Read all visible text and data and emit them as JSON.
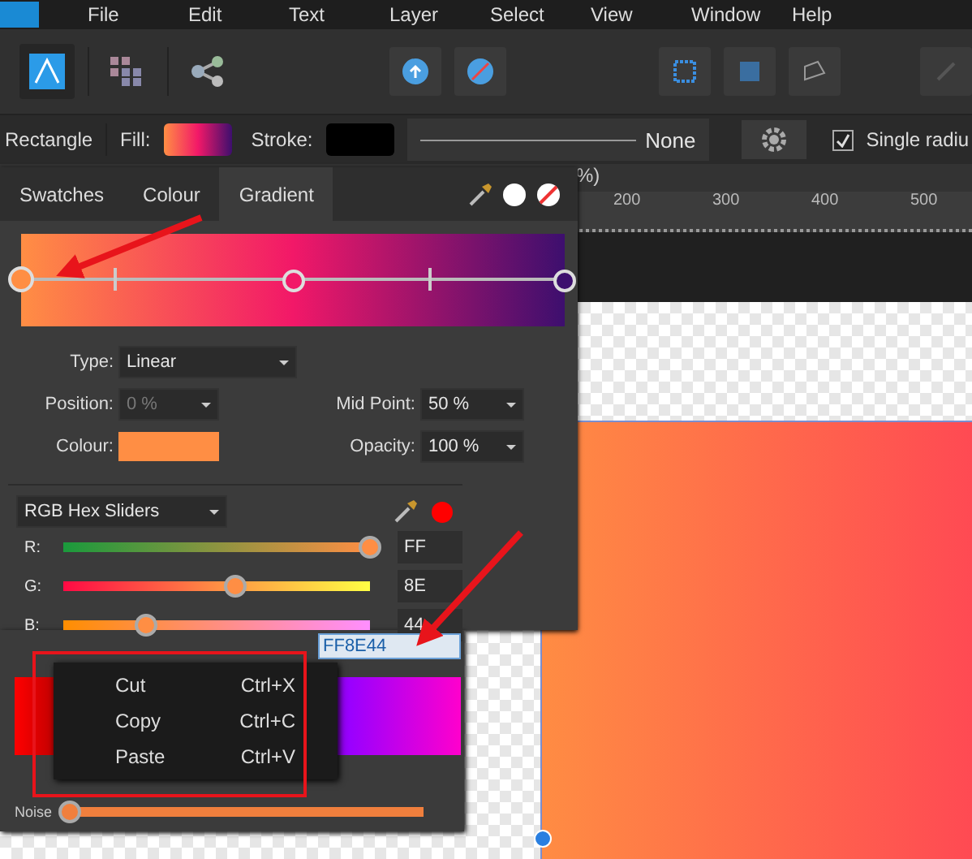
{
  "menu": [
    "File",
    "Edit",
    "Text",
    "Layer",
    "Select",
    "View",
    "Window",
    "Help"
  ],
  "context_bar": {
    "tool": "Rectangle",
    "fill_label": "Fill:",
    "stroke_label": "Stroke:",
    "stroke_style": "None",
    "single_radius": {
      "label": "Single radiu",
      "checked": true
    }
  },
  "document_tab": "%)",
  "ruler": [
    "200",
    "300",
    "400",
    "500"
  ],
  "panel": {
    "tabs": [
      {
        "label": "Swatches",
        "selected": false
      },
      {
        "label": "Colour",
        "selected": false
      },
      {
        "label": "Gradient",
        "selected": true
      }
    ],
    "stops": [
      {
        "color": "#ff8e44",
        "selected": true
      },
      {
        "color": "#f21868",
        "selected": false
      },
      {
        "color": "#3d0f6e",
        "selected": false
      }
    ],
    "type": {
      "label": "Type:",
      "value": "Linear"
    },
    "position": {
      "label": "Position:",
      "value": "0 %",
      "disabled": true
    },
    "mid_point": {
      "label": "Mid Point:",
      "value": "50 %"
    },
    "colour_label": "Colour:",
    "opacity": {
      "label": "Opacity:",
      "value": "100 %"
    },
    "colour_model": "RGB Hex Sliders",
    "sliders": [
      {
        "label": "R:",
        "level": 1.0,
        "value": "FF"
      },
      {
        "label": "G:",
        "level": 0.56,
        "value": "8E"
      },
      {
        "label": "B:",
        "level": 0.27,
        "value": "44"
      }
    ],
    "hex": "FF8E44",
    "noise": {
      "label": "Noise",
      "level": 0.0
    }
  },
  "context_menu": [
    {
      "label": "Cut",
      "shortcut": "Ctrl+X"
    },
    {
      "label": "Copy",
      "shortcut": "Ctrl+C"
    },
    {
      "label": "Paste",
      "shortcut": "Ctrl+V"
    }
  ]
}
